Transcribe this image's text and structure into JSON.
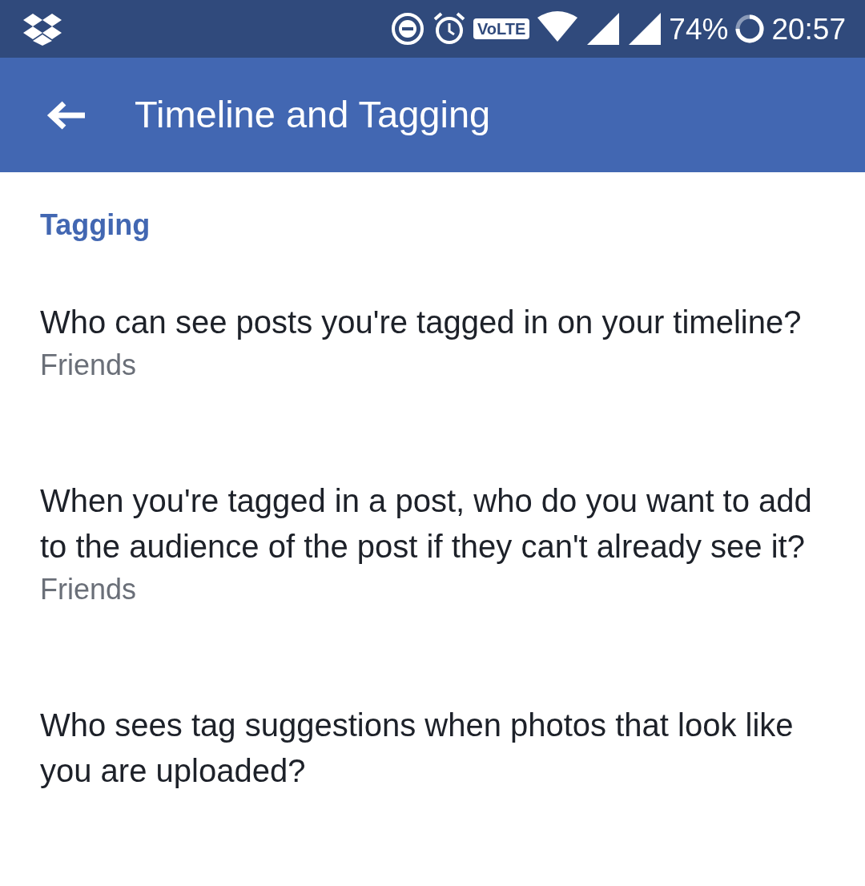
{
  "status_bar": {
    "volte": "VoLTE",
    "battery": "74%",
    "time": "20:57"
  },
  "app_bar": {
    "title": "Timeline and Tagging"
  },
  "section": {
    "title": "Tagging"
  },
  "settings": [
    {
      "question": "Who can see posts you're tagged in on your timeline?",
      "value": "Friends"
    },
    {
      "question": "When you're tagged in a post, who do you want to add to the audience of the post if they can't already see it?",
      "value": "Friends"
    },
    {
      "question": "Who sees tag suggestions when photos that look like you are uploaded?"
    }
  ]
}
